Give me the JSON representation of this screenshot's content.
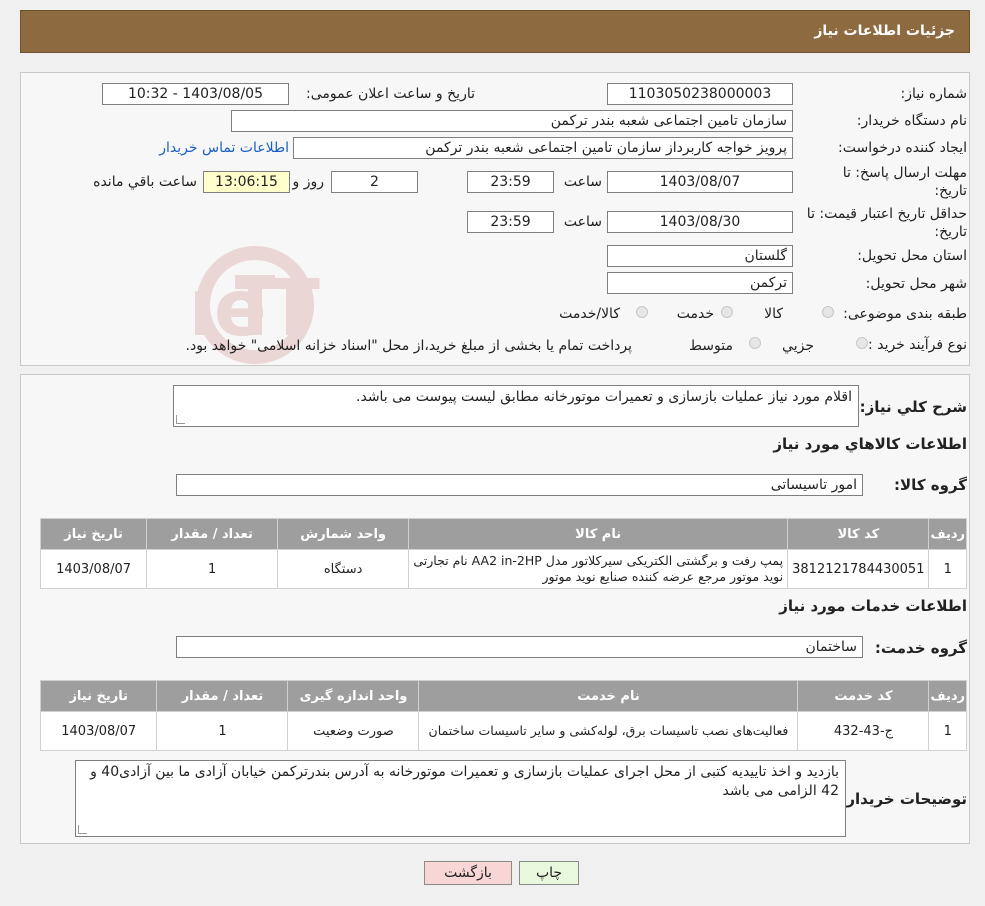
{
  "header": {
    "title": "جزئیات اطلاعات نیاز"
  },
  "labels": {
    "need_number": "شماره نیاز:",
    "announce_datetime": "تاریخ و ساعت اعلان عمومی:",
    "buyer_org": "نام دستگاه خریدار:",
    "requester": "ایجاد کننده درخواست:",
    "reply_deadline": "مهلت ارسال پاسخ: تا",
    "reply_deadline_2": "تاریخ:",
    "time_word": "ساعت",
    "day_word": "روز و",
    "remaining": "ساعت باقي مانده",
    "price_validity": "حداقل تاریخ اعتبار قیمت: تا",
    "price_validity_2": "تاریخ:",
    "province": "استان محل تحویل:",
    "city": "شهر محل تحویل:",
    "category": "طبقه بندی موضوعی:",
    "purchase_type": "نوع فرآیند خرید :"
  },
  "fields": {
    "need_number": "1103050238000003",
    "announce_datetime": "1403/08/05 - 10:32",
    "buyer_org": "سازمان تامین اجتماعی شعبه بندر ترکمن",
    "requester": "پرویز خواجه کاربرداز سازمان تامین اجتماعی شعبه بندر ترکمن",
    "contact_link": "اطلاعات تماس خریدار",
    "reply_date": "1403/08/07",
    "reply_time": "23:59",
    "reply_days": "2",
    "reply_remaining": "13:06:15",
    "validity_date": "1403/08/30",
    "validity_time": "23:59",
    "province": "گلستان",
    "city": "ترکمن"
  },
  "category_options": [
    "کالا",
    "خدمت",
    "کالا/خدمت"
  ],
  "purchase_options": [
    "جزيي",
    "متوسط"
  ],
  "purchase_note": "پرداخت تمام یا بخشی از مبلغ خرید،از محل \"اسناد خزانه اسلامی\" خواهد بود.",
  "watermark": "AriaTender.neT",
  "summary": {
    "label": "شرح کلي نياز:",
    "text": "اقلام مورد نیاز عملیات بازسازی و تعمیرات موتورخانه مطابق لیست پیوست می باشد."
  },
  "goods": {
    "section_title": "اطلاعات کالاهاي مورد نياز",
    "group_label": "گروه کالا:",
    "group_value": "امور تاسیساتی",
    "columns": [
      "رديف",
      "کد کالا",
      "نام کالا",
      "واحد شمارش",
      "تعداد / مقدار",
      "تاريخ نياز"
    ],
    "rows": [
      {
        "row": "1",
        "code": "3812121784430051",
        "name": "پمپ رفت و برگشتی الکتریکی سیرکلاتور مدل AA2 in-2HP نام تجارتی نوید موتور مرجع عرضه کننده صنایع نوید موتور",
        "unit": "دستگاه",
        "qty": "1",
        "date": "1403/08/07"
      }
    ]
  },
  "services": {
    "section_title": "اطلاعات خدمات مورد نياز",
    "group_label": "گروه خدمت:",
    "group_value": "ساختمان",
    "columns": [
      "رديف",
      "کد خدمت",
      "نام خدمت",
      "واحد اندازه گيری",
      "تعداد / مقدار",
      "تاريخ نياز"
    ],
    "rows": [
      {
        "row": "1",
        "code": "ج-43-432",
        "name": "فعالیت‌های نصب تاسیسات برق، لوله‌کشی و سایر تاسیسات ساختمان",
        "unit": "صورت وضعیت",
        "qty": "1",
        "date": "1403/08/07"
      }
    ]
  },
  "buyer_notes": {
    "label": "توضيحات خريدار:",
    "text": "بازدید و اخذ تاییدیه کتبی از محل اجرای عملیات بازسازی و تعمیرات موتورخانه به آدرس بندرترکمن خیابان آزادی ما بین آزادی40 و 42  الزامی می باشد"
  },
  "buttons": {
    "print": "چاپ",
    "back": "بازگشت"
  },
  "colors": {
    "header_bg": "#8d6a3f",
    "link": "#1a5fc4",
    "table_header": "#9e9e9e",
    "print_btn": "#e8f8dc",
    "back_btn": "#f9d6d6"
  }
}
